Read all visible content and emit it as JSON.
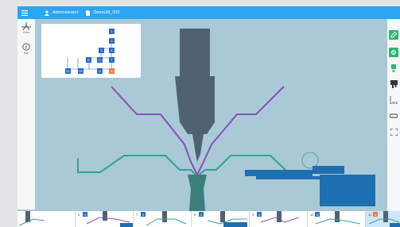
{
  "topbar": {
    "user": "Administrator",
    "program": "Demo28_003"
  },
  "left_tools": [
    {
      "label": "Rem",
      "icon": "bend-tree-icon"
    },
    {
      "label": "Info",
      "icon": "info-icon"
    }
  ],
  "right_tools": [
    {
      "icon": "edit-icon",
      "active": true
    },
    {
      "icon": "settings-icon",
      "active": true
    },
    {
      "icon": "flip-icon",
      "active": false
    },
    {
      "icon": "tool-library-icon",
      "active": false
    },
    {
      "icon": "measure-icon",
      "active": false
    },
    {
      "icon": "rotate-icon",
      "active": false
    },
    {
      "icon": "fullscreen-icon",
      "active": false
    }
  ],
  "bend_tree": {
    "nodes": [
      "1",
      "2",
      "3",
      "4",
      "5",
      "6",
      "7",
      "8",
      "9",
      "10",
      "11"
    ],
    "current": "8"
  },
  "colors": {
    "topbar": "#2aa6f2",
    "canvas": "#a9c9d7",
    "punch": "#4f6272",
    "part_before": "#8a4fb6",
    "part_after": "#2ea38e",
    "backgauge": "#1e6fb0",
    "current_node": "#f27c3a",
    "node": "#2b6cc4"
  },
  "steps": [
    {
      "num": "",
      "badge": ""
    },
    {
      "num": "6",
      "badge": "4"
    },
    {
      "num": "7",
      "badge": "5"
    },
    {
      "num": "8",
      "badge": "2"
    },
    {
      "num": "9",
      "badge": "5"
    },
    {
      "num": "10",
      "badge": "3"
    },
    {
      "num": "11",
      "badge": "8"
    }
  ]
}
